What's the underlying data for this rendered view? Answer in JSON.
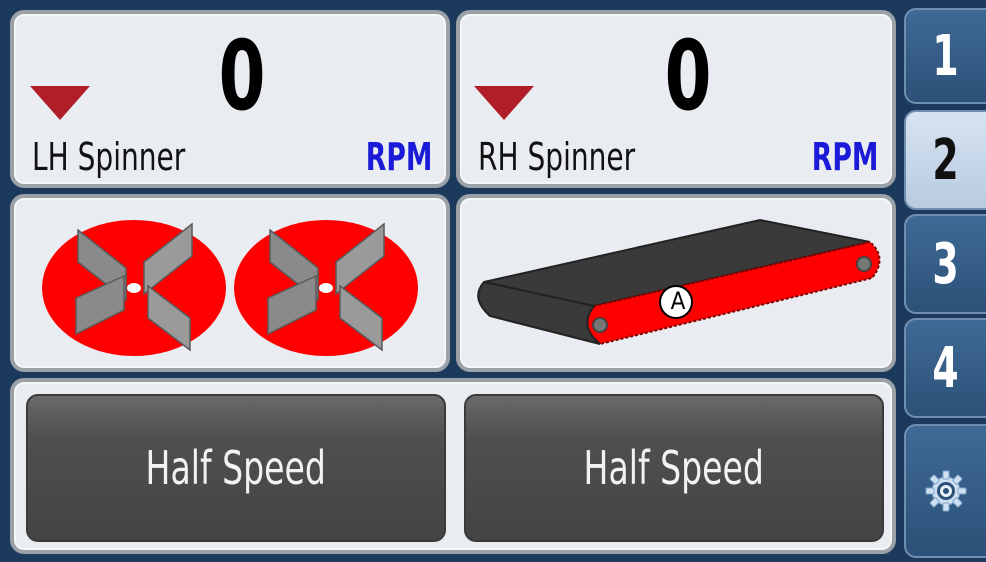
{
  "readouts": {
    "lh": {
      "value": "0",
      "label": "LH Spinner",
      "unit": "RPM"
    },
    "rh": {
      "value": "0",
      "label": "RH Spinner",
      "unit": "RPM"
    }
  },
  "belt": {
    "marker": "A"
  },
  "buttons": {
    "left": "Half Speed",
    "right": "Half Speed"
  },
  "tabs": [
    {
      "label": "1",
      "active": false
    },
    {
      "label": "2",
      "active": true
    },
    {
      "label": "3",
      "active": false
    },
    {
      "label": "4",
      "active": false
    },
    {
      "icon": "gear-icon"
    }
  ],
  "colors": {
    "spinner_red": "#ff0000",
    "decrease_arrow": "#b01e28",
    "rpm_blue": "#1a1ad8",
    "frame_navy": "#1c3a5c"
  }
}
